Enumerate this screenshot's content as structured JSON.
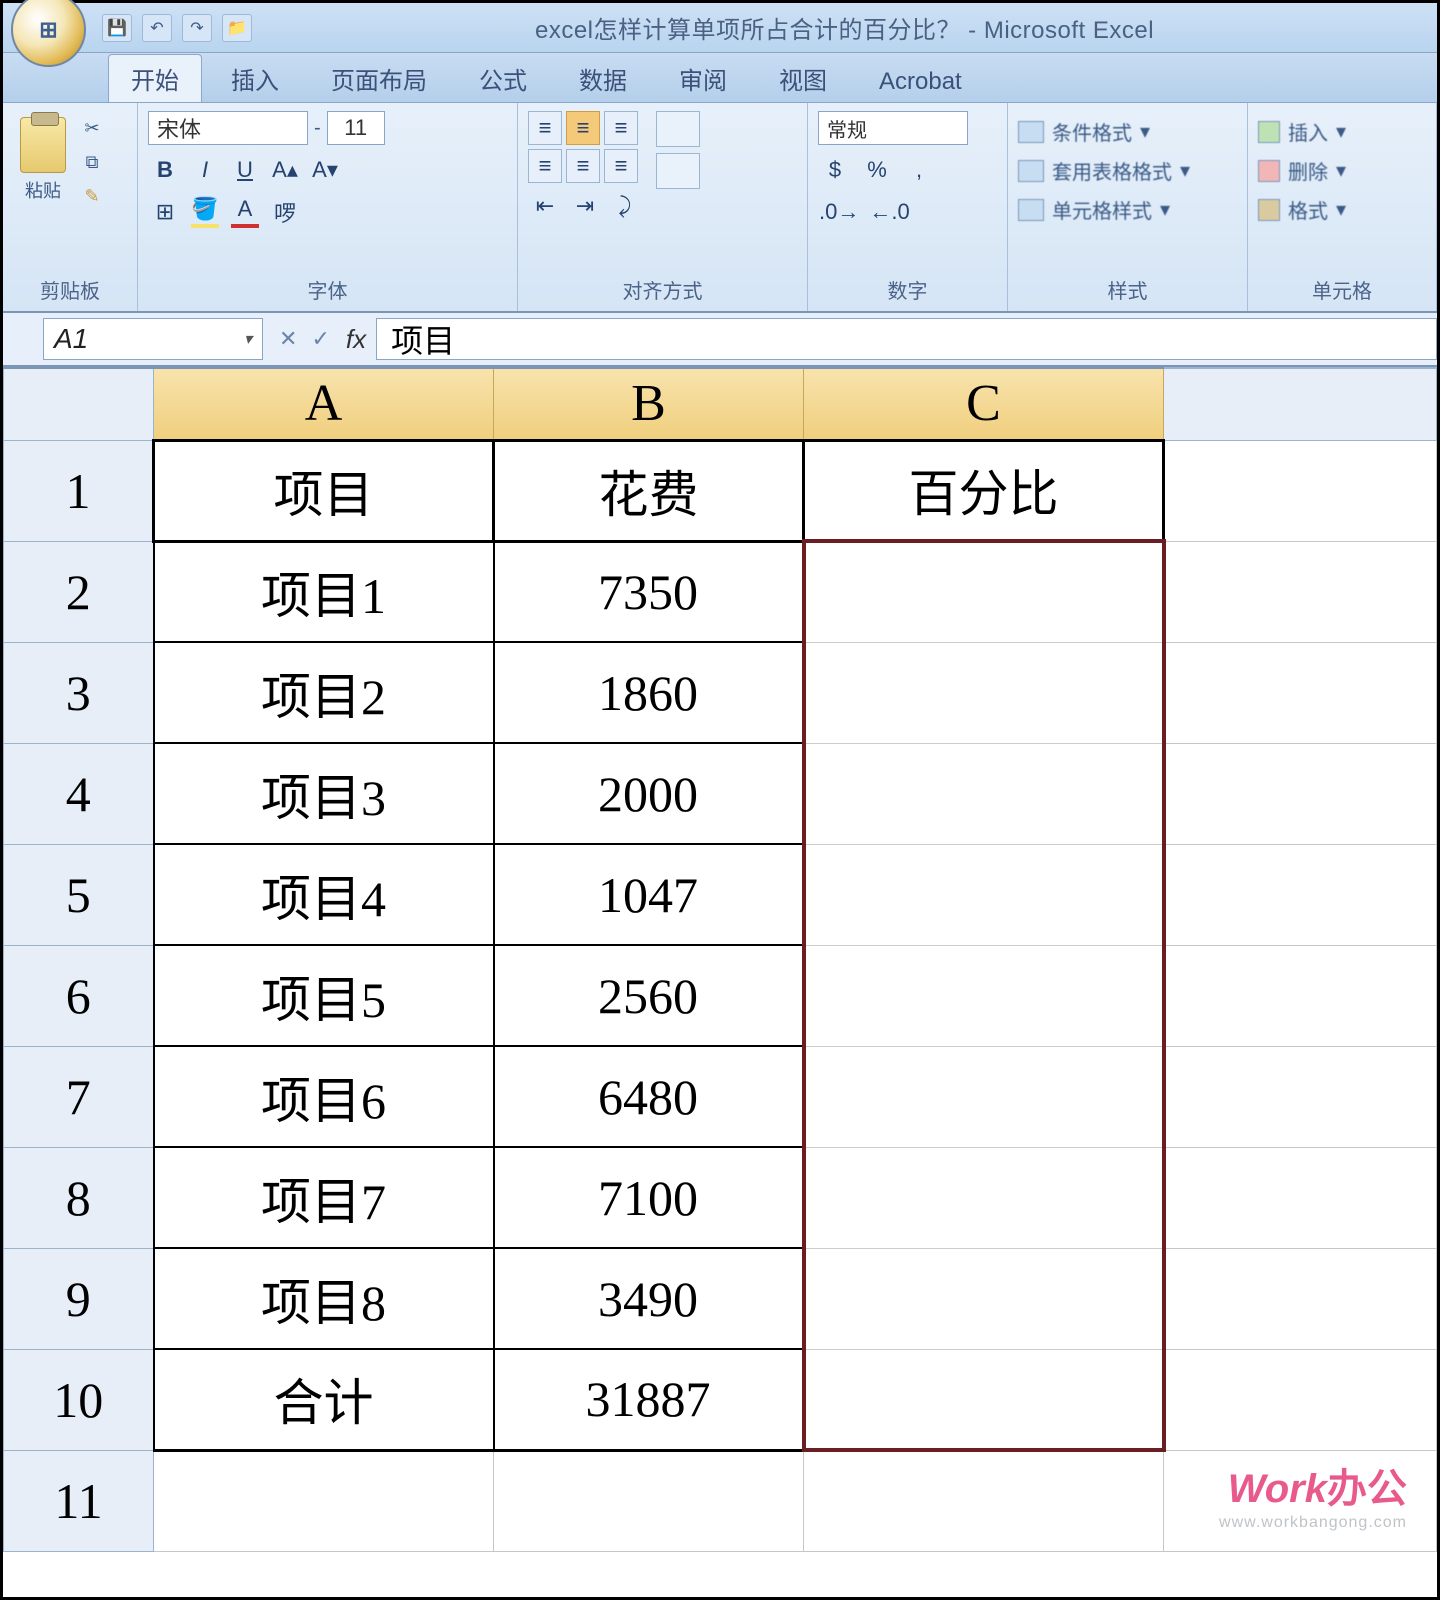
{
  "window": {
    "title": "excel怎样计算单项所占合计的百分比？ - Microsoft Excel",
    "app_short": "Excel"
  },
  "qat": {
    "save": "💾",
    "undo": "↶",
    "redo": "↷",
    "open": "📁"
  },
  "tabs": {
    "home": "开始",
    "insert": "插入",
    "layout": "页面布局",
    "formulas": "公式",
    "data": "数据",
    "review": "审阅",
    "view": "视图",
    "acrobat": "Acrobat"
  },
  "ribbon": {
    "clipboard_label": "剪贴板",
    "paste_label": "粘贴",
    "font_label": "字体",
    "font_name": "宋体",
    "font_size": "11",
    "align_label": "对齐方式",
    "number_label": "数字",
    "number_format": "常规",
    "styles_label": "样式",
    "style_cond": "条件格式",
    "style_table": "套用表格格式",
    "style_cell": "单元格样式",
    "cells_label": "单元格",
    "cells_insert": "插入",
    "cells_delete": "删除",
    "cells_format": "格式"
  },
  "formula_bar": {
    "name_box": "A1",
    "fx": "fx",
    "value": "项目"
  },
  "sheet": {
    "col_headers": [
      "A",
      "B",
      "C"
    ],
    "row_headers": [
      "1",
      "2",
      "3",
      "4",
      "5",
      "6",
      "7",
      "8",
      "9",
      "10",
      "11"
    ],
    "header_row": {
      "a": "项目",
      "b": "花费",
      "c": "百分比"
    },
    "rows": [
      {
        "a": "项目1",
        "b": "7350",
        "c": ""
      },
      {
        "a": "项目2",
        "b": "1860",
        "c": ""
      },
      {
        "a": "项目3",
        "b": "2000",
        "c": ""
      },
      {
        "a": "项目4",
        "b": "1047",
        "c": ""
      },
      {
        "a": "项目5",
        "b": "2560",
        "c": ""
      },
      {
        "a": "项目6",
        "b": "6480",
        "c": ""
      },
      {
        "a": "项目7",
        "b": "7100",
        "c": ""
      },
      {
        "a": "项目8",
        "b": "3490",
        "c": ""
      },
      {
        "a": "合计",
        "b": "31887",
        "c": ""
      }
    ]
  },
  "watermark": {
    "brand_en": "Work",
    "brand_cn": "办公",
    "url": "www.workbangong.com"
  }
}
